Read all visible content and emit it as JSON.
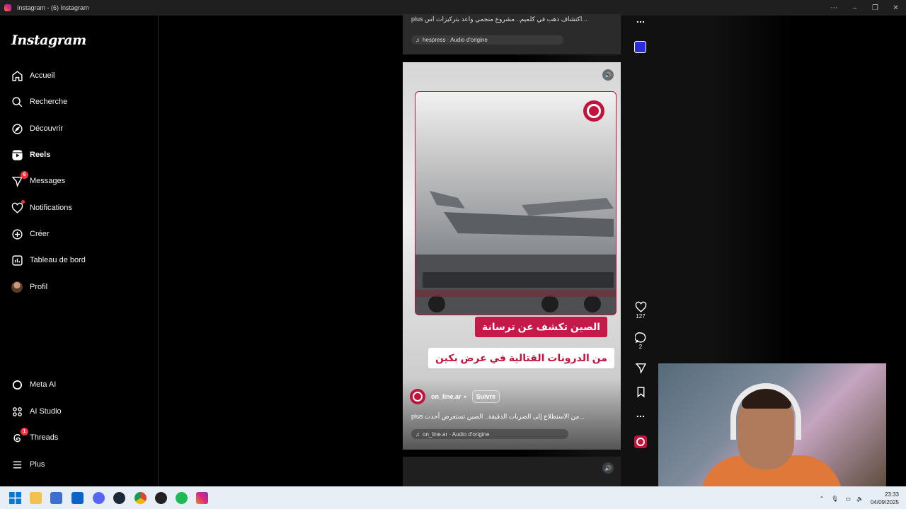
{
  "window": {
    "title": "Instagram - (6) Instagram"
  },
  "sidebar": {
    "logo": "Instagram",
    "items": [
      {
        "label": "Accueil",
        "icon": "home-icon"
      },
      {
        "label": "Recherche",
        "icon": "search-icon"
      },
      {
        "label": "Découvrir",
        "icon": "compass-icon"
      },
      {
        "label": "Reels",
        "icon": "reels-icon"
      },
      {
        "label": "Messages",
        "icon": "messenger-icon",
        "badge": "6"
      },
      {
        "label": "Notifications",
        "icon": "heart-icon"
      },
      {
        "label": "Créer",
        "icon": "plus-square-icon"
      },
      {
        "label": "Tableau de bord",
        "icon": "dashboard-icon"
      },
      {
        "label": "Profil",
        "icon": "avatar"
      }
    ],
    "bottom_items": [
      {
        "label": "Meta AI",
        "icon": "meta-ai-icon"
      },
      {
        "label": "AI Studio",
        "icon": "ai-studio-icon"
      },
      {
        "label": "Threads",
        "icon": "threads-icon",
        "badge": "1"
      },
      {
        "label": "Plus",
        "icon": "menu-icon"
      }
    ]
  },
  "prev_reel": {
    "caption": "plus  اكتشاف ذهب في كلميم.. مشروع منجمي واعد بتركيزات اس...",
    "audio": "hespress · Audio d'origine"
  },
  "reel": {
    "headline_1": "الصين تكشف عن ترسانة",
    "headline_2": "من الدرونات القتالية في عرض بكين",
    "author": "on_line.ar",
    "separator": "•",
    "follow_label": "Suivre",
    "caption": "plus  من الاستطلاع إلى الضربات الدقيقة.. الصين تستعرض أحدث...",
    "audio": "on_line.ar · Audio d'origine",
    "likes": "127",
    "comments": "2"
  },
  "taskbar": {
    "time": "23:33",
    "date": "04/09/2025"
  },
  "colors": {
    "brand_red": "#c0143c",
    "badge_red": "#ff3040",
    "taskbar_bg": "#e8eef5"
  }
}
